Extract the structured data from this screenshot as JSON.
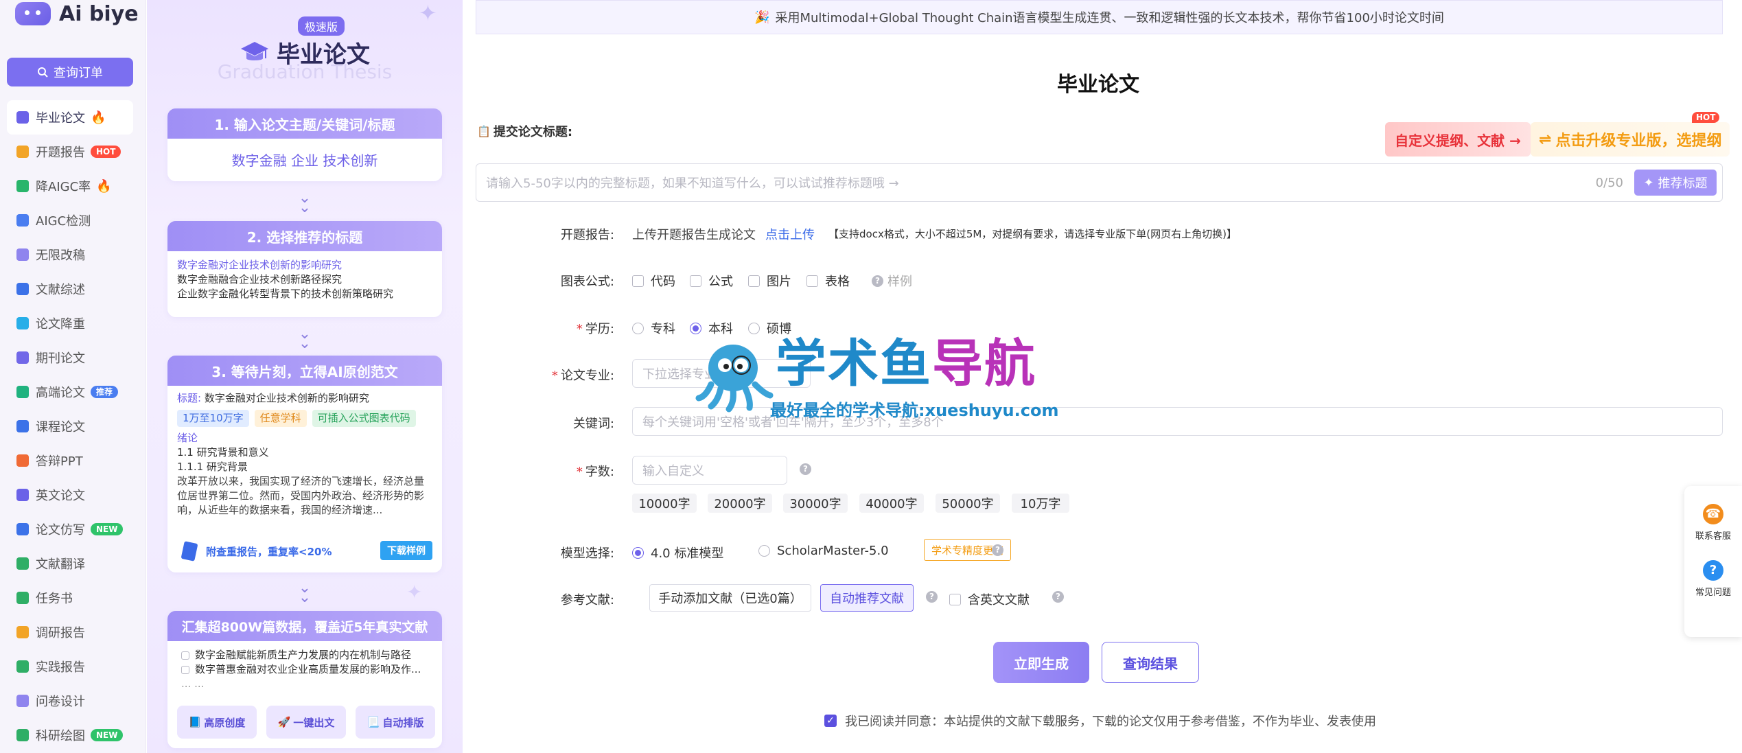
{
  "app": {
    "logo_text": "Ai biye"
  },
  "sidebar": {
    "query_button": "查询订单",
    "items": [
      {
        "label": "毕业论文",
        "icon": "cap-icon",
        "color": "#6b62e8",
        "fire": true
      },
      {
        "label": "开题报告",
        "icon": "report-icon",
        "color": "#f2a427",
        "tag": "HOT",
        "tag_color": "#ff4d3d"
      },
      {
        "label": "降AIGC率",
        "icon": "ai-icon",
        "color": "#29b56b",
        "fire": true
      },
      {
        "label": "AIGC检测",
        "icon": "detect-icon",
        "color": "#4a7df0"
      },
      {
        "label": "无限改稿",
        "icon": "edit-icon",
        "color": "#8f84ee"
      },
      {
        "label": "文献综述",
        "icon": "book-icon",
        "color": "#3c72e8"
      },
      {
        "label": "论文降重",
        "icon": "reduce-icon",
        "color": "#27aee8"
      },
      {
        "label": "期刊论文",
        "icon": "journal-icon",
        "color": "#7167e8"
      },
      {
        "label": "高端论文",
        "icon": "premium-icon",
        "color": "#20b27f",
        "tag": "推荐",
        "tag_color": "#4a7df0"
      },
      {
        "label": "课程论文",
        "icon": "course-icon",
        "color": "#3c72e8"
      },
      {
        "label": "答辩PPT",
        "icon": "ppt-icon",
        "color": "#f06a35"
      },
      {
        "label": "英文论文",
        "icon": "english-icon",
        "color": "#6b62e8"
      },
      {
        "label": "论文仿写",
        "icon": "imitate-icon",
        "color": "#3c72e8",
        "tag": "NEW",
        "tag_color": "#2fc36a"
      },
      {
        "label": "文献翻译",
        "icon": "translate-icon",
        "color": "#2fae66"
      },
      {
        "label": "任务书",
        "icon": "task-icon",
        "color": "#2fae66"
      },
      {
        "label": "调研报告",
        "icon": "survey-icon",
        "color": "#f2a427"
      },
      {
        "label": "实践报告",
        "icon": "practice-icon",
        "color": "#2fae66"
      },
      {
        "label": "问卷设计",
        "icon": "questionnaire-icon",
        "color": "#8f84ee"
      },
      {
        "label": "科研绘图",
        "icon": "chart-icon",
        "color": "#2fae66",
        "tag": "NEW",
        "tag_color": "#2fc36a"
      }
    ]
  },
  "promo": {
    "badge": "极速版",
    "title": "毕业论文",
    "ghost_title": "Graduation Thesis",
    "step1": {
      "title": "1. 输入论文主题/关键词/标题",
      "keywords": "数字金融 企业 技术创新"
    },
    "step2": {
      "title": "2. 选择推荐的标题",
      "items": [
        "数字金融对企业技术创新的影响研究",
        "数字金融融合企业技术创新路径探究",
        "企业数字金融化转型背景下的技术创新策略研究"
      ]
    },
    "step3": {
      "title": "3. 等待片刻，立得AI原创范文",
      "title_prefix": "标题:",
      "title_value": "数字金融对企业技术创新的影响研究",
      "tags": [
        "1万至10万字",
        "任意学科",
        "可插入公式图表代码"
      ],
      "section": "绪论",
      "subsections": [
        "1.1 研究背景和意义",
        "1.1.1 研究背景"
      ],
      "body": "改革开放以来，我国实现了经济的飞速增长，经济总量位居世界第二位。然而，受国内外政治、经济形势的影响，从近些年的数据来看，我国的经济增速...",
      "footer_text": "附查重报告，重复率<20%",
      "download": "下载样例"
    },
    "step4": {
      "title": "汇集超800W篇数据，覆盖近5年真实文献",
      "items": [
        "数字金融赋能新质生产力发展的内在机制与路径",
        "数字普惠金融对农业企业高质量发展的影响及作..."
      ],
      "more": "... ...",
      "buttons": [
        "高原创度",
        "一键出文",
        "自动排版"
      ]
    }
  },
  "main": {
    "banner": "采用Multimodal+Global Thought Chain语言模型生成连贯、一致和逻辑性强的长文本技术，帮你节省100小时论文时间",
    "page_title": "毕业论文",
    "submit_label": "提交论文标题:",
    "custom_outline": "自定义提纲、文献 →",
    "upgrade": "点击升级专业版，选提纲",
    "hot": "HOT",
    "title_input": {
      "placeholder": "请输入5-50字以内的完整标题，如果不知道写什么，可以试试推荐标题哦 →",
      "counter": "0/50",
      "recommend_button": "推荐标题"
    },
    "proposal": {
      "label": "开题报告:",
      "text": "上传开题报告生成论文",
      "link": "点击上传",
      "note": "【支持docx格式，大小不超过5M，对提纲有要求，请选择专业版下单(网页右上角切换)】"
    },
    "charts": {
      "label": "图表公式:",
      "options": [
        "代码",
        "公式",
        "图片",
        "表格"
      ],
      "sample": "样例"
    },
    "degree": {
      "label": "学历:",
      "options": [
        "专科",
        "本科",
        "硕博"
      ],
      "selected": "本科"
    },
    "major": {
      "label": "论文专业:",
      "placeholder": "下拉选择专业"
    },
    "keywords": {
      "label": "关键词:",
      "placeholder": "每个关键词用'空格'或者'回车'隔开，至少3个，至多8个"
    },
    "wordcount": {
      "label": "字数:",
      "placeholder": "输入自定义",
      "options": [
        "10000字",
        "20000字",
        "30000字",
        "40000字",
        "50000字",
        "10万字"
      ]
    },
    "model": {
      "label": "模型选择:",
      "options": [
        "4.0 标准模型",
        "ScholarMaster-5.0"
      ],
      "selected": "4.0 标准模型",
      "badge": "学术专精度更高"
    },
    "refs": {
      "label": "参考文献:",
      "manual": "手动添加文献（已选0篇）",
      "auto": "自动推荐文献",
      "english": "含英文文献"
    },
    "generate": "立即生成",
    "query_result": "查询结果",
    "agree": "我已阅读并同意：本站提供的文献下载服务，下载的论文仅用于参考借鉴，不作为毕业、发表使用"
  },
  "watermark": {
    "title_a": "学术鱼",
    "title_b": "导航",
    "subtitle": "最好最全的学术导航:xueshuyu.com"
  },
  "float": {
    "service": "联系客服",
    "faq": "常见问题"
  }
}
